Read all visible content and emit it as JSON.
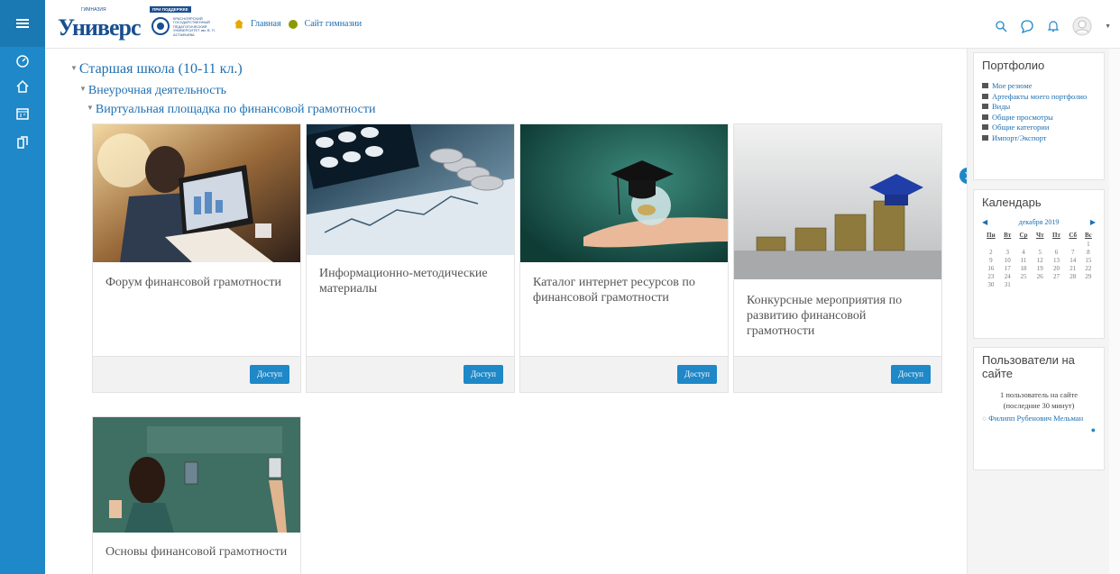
{
  "header": {
    "logo": {
      "top_label": "ГИМНАЗИЯ",
      "word": "Универс",
      "tag": "ПРИ ПОДДЕРЖКЕ",
      "org": "КРАСНОЯРСКИЙ ГОСУДАРСТВЕННЫЙ ПЕДАГОГИЧЕСКИЙ УНИВЕРСИТЕТ им. В. П. АСТАФЬЕВА"
    },
    "nav": {
      "home": "Главная",
      "site": "Сайт гимназии"
    }
  },
  "breadcrumb": {
    "level1": "Старшая школа (10-11 кл.)",
    "level2": "Внеурочная деятельность",
    "level3": "Виртуальная площадка по финансовой грамотности"
  },
  "cards": [
    {
      "title": "Форум финансовой грамотности",
      "button": "Доступ"
    },
    {
      "title": "Информационно-методические материалы",
      "button": "Доступ"
    },
    {
      "title": "Каталог интернет ресурсов по финансовой грамотности",
      "button": "Доступ"
    },
    {
      "title": "Конкурсные мероприятия по развитию финансовой грамотности",
      "button": "Доступ"
    },
    {
      "title": "Основы финансовой грамотности",
      "button": ""
    }
  ],
  "portfolio": {
    "title": "Портфолио",
    "items": [
      "Мое резюме",
      "Артефакты моего портфолио",
      "Виды",
      "Общие просмотры",
      "Общие категории",
      "Импорт/Экспорт"
    ]
  },
  "calendar": {
    "title": "Календарь",
    "month": "декабря 2019",
    "weekdays": [
      "Пн",
      "Вт",
      "Ср",
      "Чт",
      "Пт",
      "Сб",
      "Вс"
    ],
    "weeks": [
      [
        "",
        "",
        "",
        "",
        "",
        "",
        "1"
      ],
      [
        "2",
        "3",
        "4",
        "5",
        "6",
        "7",
        "8"
      ],
      [
        "9",
        "10",
        "11",
        "12",
        "13",
        "14",
        "15"
      ],
      [
        "16",
        "17",
        "18",
        "19",
        "20",
        "21",
        "22"
      ],
      [
        "23",
        "24",
        "25",
        "26",
        "27",
        "28",
        "29"
      ],
      [
        "30",
        "31",
        "",
        "",
        "",
        "",
        ""
      ]
    ]
  },
  "online_users": {
    "title": "Пользователи на сайте",
    "summary": "1 пользователь на сайте (последние 30 минут)",
    "user": "Филипп Рубенович Мельман"
  },
  "colors": {
    "primary": "#1e88c8",
    "rail": "#1e88c8"
  }
}
